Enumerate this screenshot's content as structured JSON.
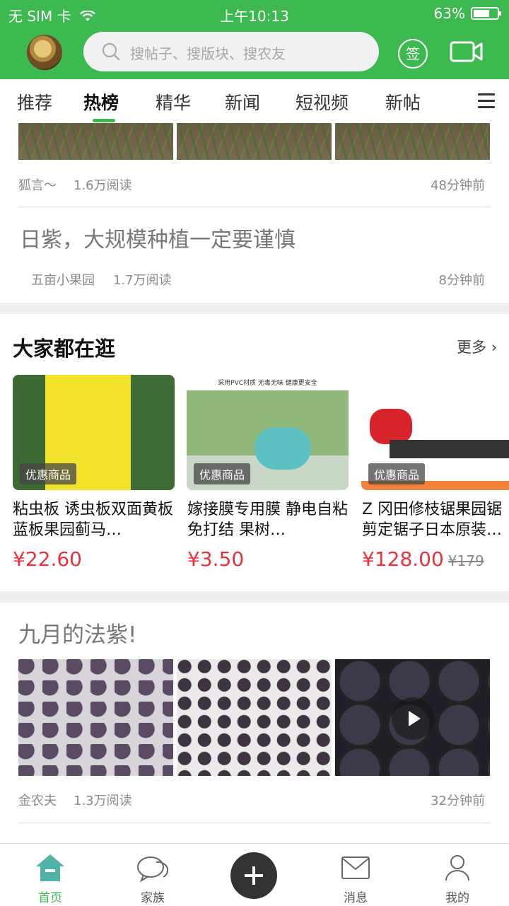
{
  "status": {
    "carrier": "无 SIM 卡",
    "time": "上午10:13",
    "battery": "63%"
  },
  "header": {
    "search_placeholder": "搜帖子、搜版块、搜农友",
    "sign_label": "签"
  },
  "tabs": [
    {
      "label": "推荐"
    },
    {
      "label": "热榜"
    },
    {
      "label": "精华"
    },
    {
      "label": "新闻"
    },
    {
      "label": "短视频"
    },
    {
      "label": "新帖"
    }
  ],
  "active_tab": "热榜",
  "posts": [
    {
      "author": "狐言～",
      "reads": "1.6万阅读",
      "time": "48分钟前"
    },
    {
      "title": "日紫，大规模种植一定要谨慎",
      "author": "五亩小果园",
      "reads": "1.7万阅读",
      "time": "8分钟前"
    },
    {
      "title": "九月的法紫!",
      "author": "金农夫",
      "reads": "1.3万阅读",
      "time": "32分钟前"
    }
  ],
  "shopping": {
    "title": "大家都在逛",
    "more": "更多",
    "banner_text": "采用PVC材质 无毒无味 健康更安全",
    "products": [
      {
        "tag": "优惠商品",
        "name": "粘虫板 诱虫板双面黄板蓝板果园蓟马…",
        "price": "¥22.60",
        "old_price": ""
      },
      {
        "tag": "优惠商品",
        "name": "嫁接膜专用膜 静电自粘免打结 果树…",
        "price": "¥3.50",
        "old_price": ""
      },
      {
        "tag": "优惠商品",
        "name": "Z 冈田修枝锯果园锯剪定锯子日本原装…",
        "price": "¥128.00",
        "old_price": "¥179"
      }
    ]
  },
  "bottom_nav": [
    {
      "label": "首页"
    },
    {
      "label": "家族"
    },
    {
      "label": "消息"
    },
    {
      "label": "我的"
    }
  ],
  "colors": {
    "brand": "#3cb94f",
    "price": "#e8333f"
  }
}
